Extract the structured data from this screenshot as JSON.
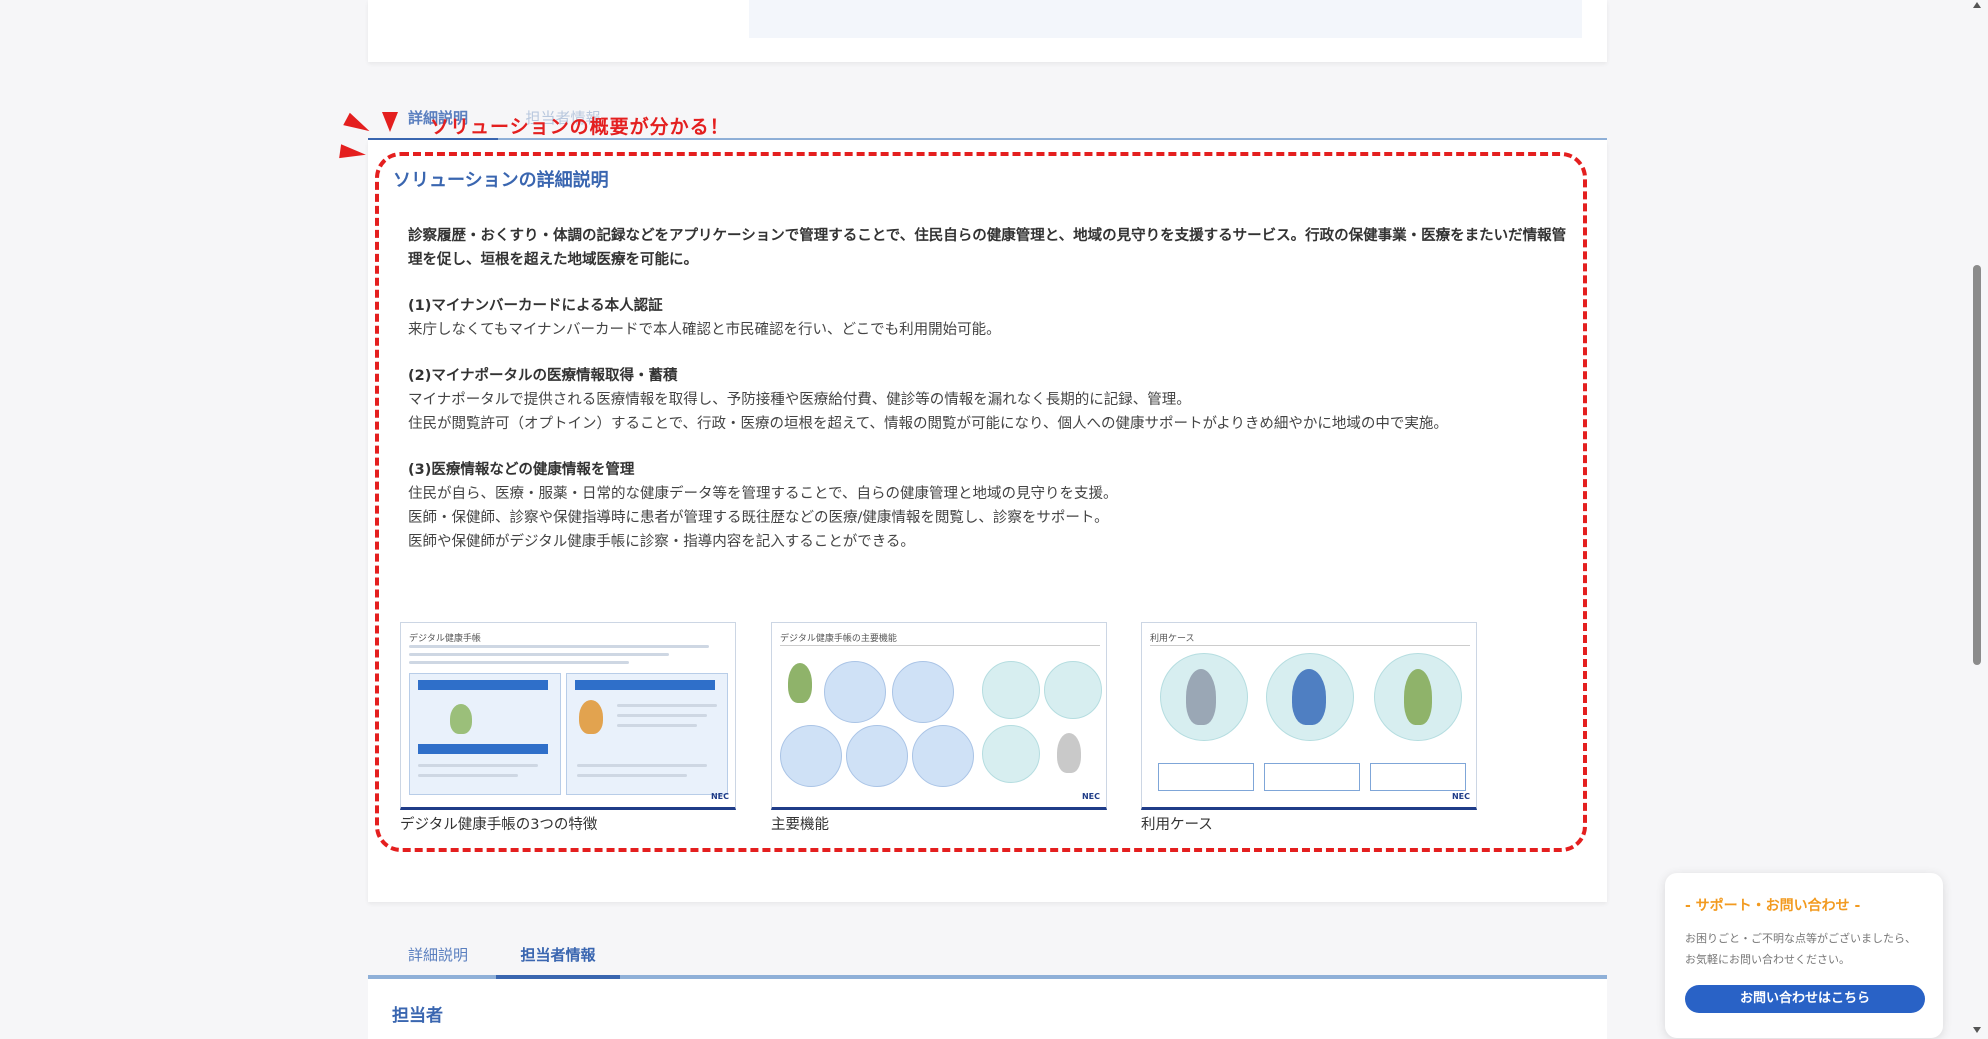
{
  "tabs_top": {
    "detail_label": "詳細説明",
    "person_label": "担当者情報"
  },
  "annotation": {
    "text": "ソリューションの概要が分かる！",
    "color": "#e41f1f"
  },
  "section": {
    "title": "ソリューションの詳細説明",
    "lead": "診察履歴・おくすり・体調の記録などをアプリケーションで管理することで、住民自らの健康管理と、地域の見守りを支援するサービス。行政の保健事業・医療をまたいだ情報管理を促し、垣根を超えた地域医療を可能に。",
    "items": [
      {
        "heading": "(1)マイナンバーカードによる本人認証",
        "lines": [
          "来庁しなくてもマイナンバーカードで本人確認と市民確認を行い、どこでも利用開始可能。"
        ]
      },
      {
        "heading": "(2)マイナポータルの医療情報取得・蓄積",
        "lines": [
          "マイナポータルで提供される医療情報を取得し、予防接種や医療給付費、健診等の情報を漏れなく長期的に記録、管理。",
          "住民が閲覧許可（オプトイン）することで、行政・医療の垣根を超えて、情報の閲覧が可能になり、個人への健康サポートがよりきめ細やかに地域の中で実施。"
        ]
      },
      {
        "heading": "(3)医療情報などの健康情報を管理",
        "lines": [
          "住民が自ら、医療・服薬・日常的な健康データ等を管理することで、自らの健康管理と地域の見守りを支援。",
          "医師・保健師、診察や保健指導時に患者が管理する既往歴などの医療/健康情報を閲覧し、診察をサポート。",
          "医師や保健師がデジタル健康手帳に診察・指導内容を記入することができる。"
        ]
      }
    ]
  },
  "thumbnails": [
    {
      "caption": "デジタル健康手帳の3つの特徴",
      "inner_title": "デジタル健康手帳",
      "logo": "NEC"
    },
    {
      "caption": "主要機能",
      "inner_title": "デジタル健康手帳の主要機能",
      "logo": "NEC"
    },
    {
      "caption": "利用ケース",
      "inner_title": "利用ケース",
      "logo": "NEC"
    }
  ],
  "tabs_bottom": {
    "detail_label": "詳細説明",
    "person_label": "担当者情報"
  },
  "person_section": {
    "title": "担当者"
  },
  "support": {
    "title": "- サポート・お問い合わせ -",
    "desc": "お困りごと・ご不明な点等がございましたら、お気軽にお問い合わせください。",
    "button": "お問い合わせはこちら"
  },
  "colors": {
    "accent": "#3a66b0",
    "button": "#2962c6",
    "support_title": "#f29a1f"
  }
}
